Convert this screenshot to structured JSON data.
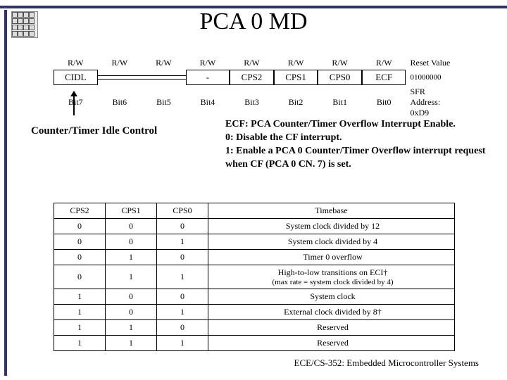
{
  "title": "PCA 0 MD",
  "register": {
    "header_rw": [
      "R/W",
      "R/W",
      "R/W",
      "R/W",
      "R/W",
      "R/W",
      "R/W",
      "R/W"
    ],
    "header_reset_label": "Reset Value",
    "fields": [
      "CIDL",
      "",
      "",
      "-",
      "CPS2",
      "CPS1",
      "CPS0",
      "ECF"
    ],
    "reset_value": "01000000",
    "bits": [
      "Bit7",
      "Bit6",
      "Bit5",
      "Bit4",
      "Bit3",
      "Bit2",
      "Bit1",
      "Bit0"
    ],
    "sfr_label": "SFR Address:",
    "sfr_addr": "0xD9"
  },
  "left_label": "Counter/Timer Idle Control",
  "ecf": {
    "line1": "ECF: PCA Counter/Timer Overflow Interrupt Enable.",
    "line2": "0: Disable the CF interrupt.",
    "line3": "1: Enable a PCA 0 Counter/Timer Overflow interrupt request  when CF (PCA 0 CN. 7) is set."
  },
  "timebase": {
    "headers": [
      "CPS2",
      "CPS1",
      "CPS0",
      "Timebase"
    ],
    "rows": [
      {
        "c": [
          "0",
          "0",
          "0"
        ],
        "t": "System clock divided by 12",
        "sub": ""
      },
      {
        "c": [
          "0",
          "0",
          "1"
        ],
        "t": "System clock divided by 4",
        "sub": ""
      },
      {
        "c": [
          "0",
          "1",
          "0"
        ],
        "t": "Timer 0 overflow",
        "sub": ""
      },
      {
        "c": [
          "0",
          "1",
          "1"
        ],
        "t": "High-to-low transitions on ECI†",
        "sub": "(max rate = system clock divided by 4)"
      },
      {
        "c": [
          "1",
          "0",
          "0"
        ],
        "t": "System clock",
        "sub": ""
      },
      {
        "c": [
          "1",
          "0",
          "1"
        ],
        "t": "External clock divided by 8†",
        "sub": ""
      },
      {
        "c": [
          "1",
          "1",
          "0"
        ],
        "t": "Reserved",
        "sub": ""
      },
      {
        "c": [
          "1",
          "1",
          "1"
        ],
        "t": "Reserved",
        "sub": ""
      }
    ]
  },
  "footer": "ECE/CS-352: Embedded Microcontroller Systems"
}
